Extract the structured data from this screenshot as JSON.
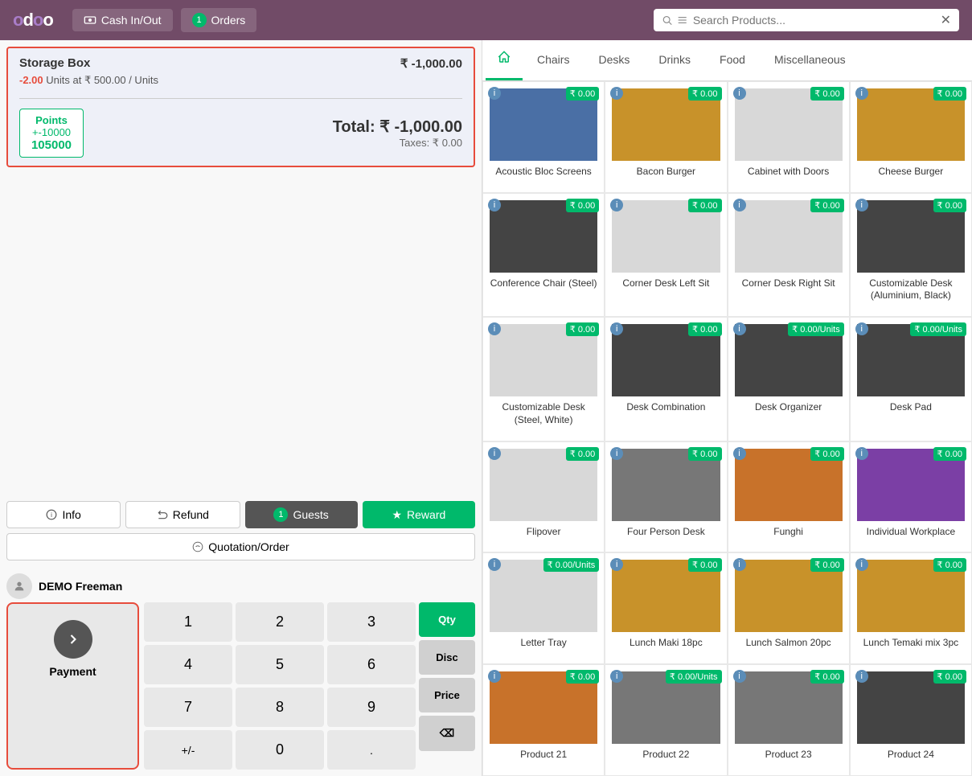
{
  "app": {
    "logo": "odoo",
    "logo_dot": "●"
  },
  "nav": {
    "cash_in_out_label": "Cash In/Out",
    "orders_label": "Orders",
    "orders_badge": "1",
    "search_placeholder": "Search Products..."
  },
  "order": {
    "item_name": "Storage Box",
    "item_price": "₹ -1,000.00",
    "item_detail_qty": "-2.00",
    "item_detail_unit": "Units at ₹ 500.00 / Units",
    "points_label": "Points",
    "points_change": "+-10000",
    "points_total": "105000",
    "total_label": "Total:",
    "total_value": "₹ -1,000.00",
    "taxes_label": "Taxes: ₹ 0.00"
  },
  "buttons": {
    "info_label": "Info",
    "refund_label": "Refund",
    "guests_label": "Guests",
    "guests_badge": "1",
    "reward_label": "Reward",
    "quotation_label": "Quotation/Order",
    "payment_label": "Payment"
  },
  "numpad": {
    "customer_name": "DEMO Freeman",
    "keys": [
      "1",
      "2",
      "3",
      "4",
      "5",
      "6",
      "7",
      "8",
      "9",
      "+/-",
      "0",
      "."
    ],
    "side_buttons": [
      "Qty",
      "Disc",
      "Price",
      "⌫"
    ],
    "qty_active": true
  },
  "categories": {
    "home_label": "🏠",
    "tabs": [
      "Chairs",
      "Desks",
      "Drinks",
      "Food",
      "Miscellaneous"
    ]
  },
  "products": [
    {
      "id": 1,
      "name": "Acoustic Bloc Screens",
      "price": "₹ 0.00",
      "img_color": "img-blue",
      "has_info": true
    },
    {
      "id": 2,
      "name": "Bacon Burger",
      "price": "₹ 0.00",
      "img_color": "img-food",
      "has_info": true
    },
    {
      "id": 3,
      "name": "Cabinet with Doors",
      "price": "₹ 0.00",
      "img_color": "img-white",
      "has_info": true
    },
    {
      "id": 4,
      "name": "Cheese Burger",
      "price": "₹ 0.00",
      "img_color": "img-food",
      "has_info": true
    },
    {
      "id": 5,
      "name": "Conference Chair (Steel)",
      "price": "₹ 0.00",
      "img_color": "img-dark",
      "has_info": true
    },
    {
      "id": 6,
      "name": "Corner Desk Left Sit",
      "price": "₹ 0.00",
      "img_color": "img-white",
      "has_info": true
    },
    {
      "id": 7,
      "name": "Corner Desk Right Sit",
      "price": "₹ 0.00",
      "img_color": "img-white",
      "has_info": true
    },
    {
      "id": 8,
      "name": "Customizable Desk (Aluminium, Black)",
      "price": "₹ 0.00",
      "img_color": "img-dark",
      "has_info": true
    },
    {
      "id": 9,
      "name": "Customizable Desk (Steel, White)",
      "price": "₹ 0.00",
      "img_color": "img-white",
      "has_info": true
    },
    {
      "id": 10,
      "name": "Desk Combination",
      "price": "₹ 0.00",
      "img_color": "img-dark",
      "has_info": true
    },
    {
      "id": 11,
      "name": "Desk Organizer",
      "price": "₹ 0.00/Units",
      "img_color": "img-dark",
      "has_info": true
    },
    {
      "id": 12,
      "name": "Desk Pad",
      "price": "₹ 0.00/Units",
      "img_color": "img-dark",
      "has_info": true
    },
    {
      "id": 13,
      "name": "Flipover",
      "price": "₹ 0.00",
      "img_color": "img-white",
      "has_info": true
    },
    {
      "id": 14,
      "name": "Four Person Desk",
      "price": "₹ 0.00",
      "img_color": "img-gray",
      "has_info": true
    },
    {
      "id": 15,
      "name": "Funghi",
      "price": "₹ 0.00",
      "img_color": "img-orange",
      "has_info": true
    },
    {
      "id": 16,
      "name": "Individual Workplace",
      "price": "₹ 0.00",
      "img_color": "img-purple",
      "has_info": true
    },
    {
      "id": 17,
      "name": "Letter Tray",
      "price": "₹ 0.00/Units",
      "img_color": "img-white",
      "has_info": true
    },
    {
      "id": 18,
      "name": "Lunch Maki 18pc",
      "price": "₹ 0.00",
      "img_color": "img-food",
      "has_info": true
    },
    {
      "id": 19,
      "name": "Lunch Salmon 20pc",
      "price": "₹ 0.00",
      "img_color": "img-food",
      "has_info": true
    },
    {
      "id": 20,
      "name": "Lunch Temaki mix 3pc",
      "price": "₹ 0.00",
      "img_color": "img-food",
      "has_info": true
    },
    {
      "id": 21,
      "name": "Product 21",
      "price": "₹ 0.00",
      "img_color": "img-orange",
      "has_info": true
    },
    {
      "id": 22,
      "name": "Product 22",
      "price": "₹ 0.00/Units",
      "img_color": "img-gray",
      "has_info": true
    },
    {
      "id": 23,
      "name": "Product 23",
      "price": "₹ 0.00",
      "img_color": "img-gray",
      "has_info": true
    },
    {
      "id": 24,
      "name": "Product 24",
      "price": "₹ 0.00",
      "img_color": "img-dark",
      "has_info": true
    }
  ],
  "colors": {
    "accent": "#00b96b",
    "brand": "#714b67",
    "danger": "#e74c3c",
    "info": "#5b8db8"
  }
}
